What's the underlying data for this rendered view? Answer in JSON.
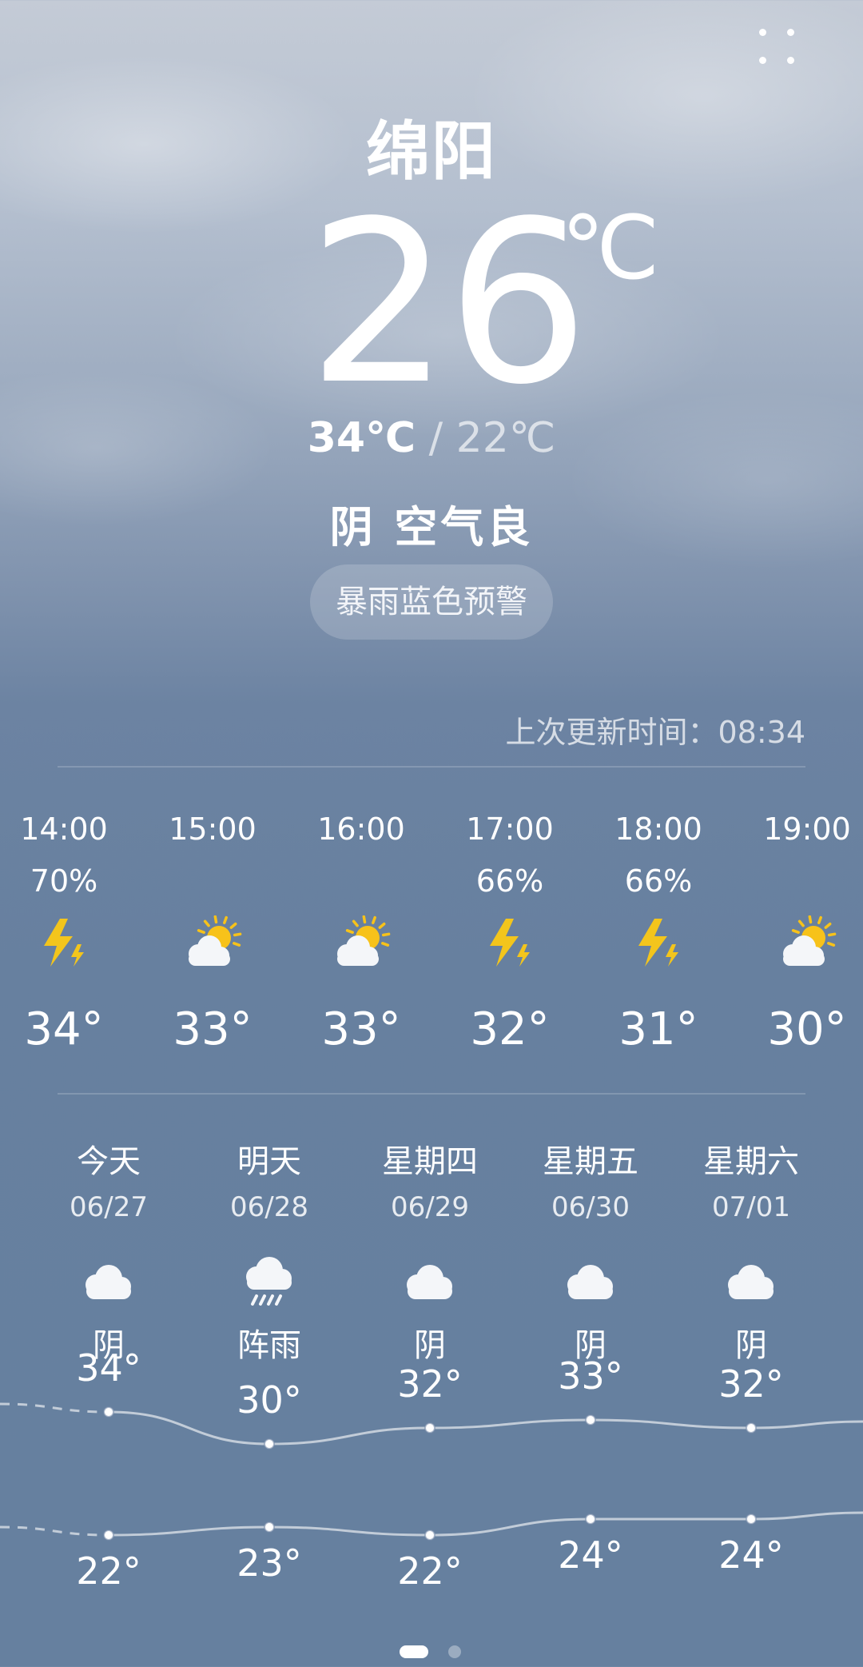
{
  "header": {
    "city": "绵阳",
    "current_temp": "26",
    "temp_unit": "℃",
    "high": "34℃",
    "separator": " / ",
    "low": "22℃",
    "condition": "阴",
    "air_quality": "空气良",
    "warning": "暴雨蓝色预警"
  },
  "update": {
    "label": "上次更新时间：",
    "time": "08:34"
  },
  "hourly": [
    {
      "time": "14:00",
      "precip": "70%",
      "icon": "thunder-icon",
      "temp": "34°"
    },
    {
      "time": "15:00",
      "precip": "",
      "icon": "partly-cloudy-icon",
      "temp": "33°"
    },
    {
      "time": "16:00",
      "precip": "",
      "icon": "partly-cloudy-icon",
      "temp": "33°"
    },
    {
      "time": "17:00",
      "precip": "66%",
      "icon": "thunder-icon",
      "temp": "32°"
    },
    {
      "time": "18:00",
      "precip": "66%",
      "icon": "thunder-icon",
      "temp": "31°"
    },
    {
      "time": "19:00",
      "precip": "",
      "icon": "partly-cloudy-icon",
      "temp": "30°"
    }
  ],
  "daily": [
    {
      "name": "今天",
      "date": "06/27",
      "icon": "cloudy-icon",
      "condition": "阴",
      "high": "34°",
      "low": "22°"
    },
    {
      "name": "明天",
      "date": "06/28",
      "icon": "rain-icon",
      "condition": "阵雨",
      "high": "30°",
      "low": "23°"
    },
    {
      "name": "星期四",
      "date": "06/29",
      "icon": "cloudy-icon",
      "condition": "阴",
      "high": "32°",
      "low": "22°"
    },
    {
      "name": "星期五",
      "date": "06/30",
      "icon": "cloudy-icon",
      "condition": "阴",
      "high": "33°",
      "low": "24°"
    },
    {
      "name": "星期六",
      "date": "07/01",
      "icon": "cloudy-icon",
      "condition": "阴",
      "high": "32°",
      "low": "24°"
    }
  ],
  "pager": {
    "pages": 2,
    "current": 1
  },
  "colors": {
    "sun": "#f7c21a",
    "bolt": "#f3c51c",
    "cloud": "#f4f6f9"
  }
}
